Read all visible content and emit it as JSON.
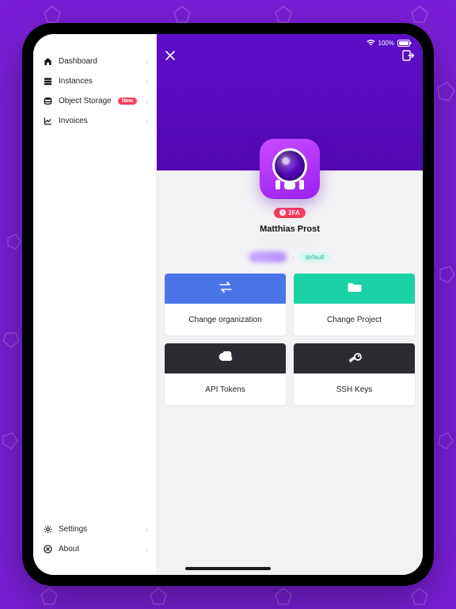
{
  "status": {
    "battery_text": "100%"
  },
  "sidebar": {
    "items": [
      {
        "label": "Dashboard"
      },
      {
        "label": "Instances"
      },
      {
        "label": "Object Storage",
        "badge": "New"
      },
      {
        "label": "Invoices"
      }
    ],
    "bottom": [
      {
        "label": "Settings"
      },
      {
        "label": "About"
      }
    ]
  },
  "profile": {
    "twofa_label": "2FA",
    "name": "Matthias Prost",
    "crumb_default": "default"
  },
  "cards": {
    "change_org": "Change organization",
    "change_project": "Change Project",
    "api_tokens": "API Tokens",
    "ssh_keys": "SSH Keys"
  }
}
